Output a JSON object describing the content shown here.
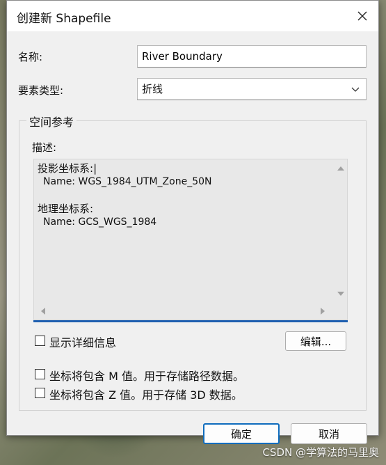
{
  "dialog": {
    "title": "创建新 Shapefile"
  },
  "form": {
    "name_label": "名称:",
    "name_value": "River Boundary",
    "feature_type_label": "要素类型:",
    "feature_type_value": "折线"
  },
  "spatial_ref": {
    "group_title": "空间参考",
    "desc_label": "描述:",
    "projected_heading": "投影坐标系:",
    "projected_name": "Name: WGS_1984_UTM_Zone_50N",
    "geographic_heading": "地理坐标系:",
    "geographic_name": "Name: GCS_WGS_1984",
    "show_details_label": "显示详细信息",
    "edit_button": "编辑..."
  },
  "options": {
    "m_values_label": "坐标将包含 M 值。用于存储路径数据。",
    "z_values_label": "坐标将包含 Z 值。用于存储 3D 数据。"
  },
  "buttons": {
    "ok": "确定",
    "cancel": "取消"
  },
  "watermark": "CSDN @学算法的马里奥"
}
